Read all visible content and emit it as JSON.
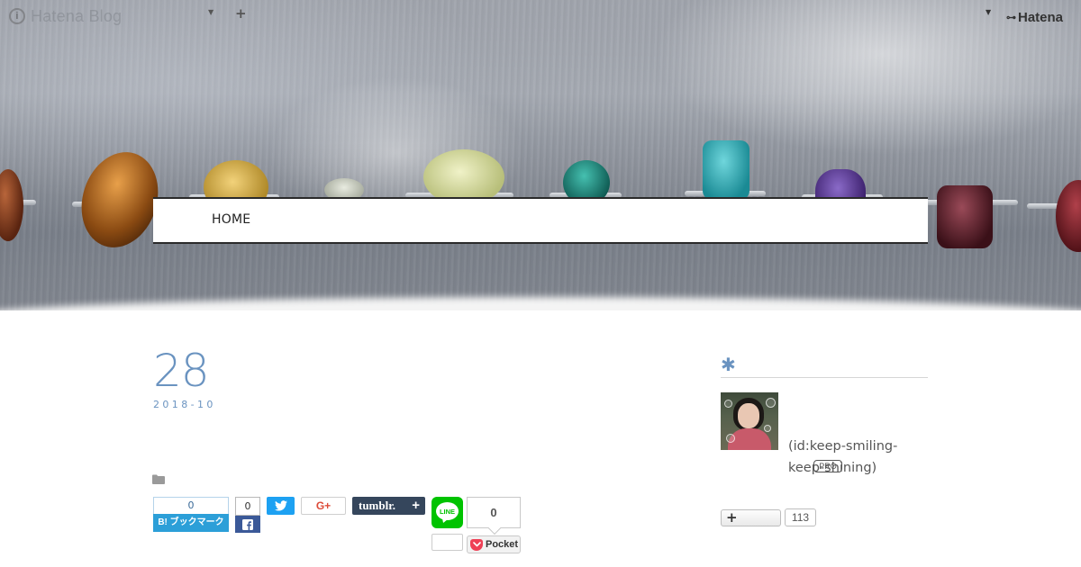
{
  "topbar": {
    "logo_text": "Hatena Blog",
    "logo_mark": "i",
    "dropdown_icon": "caret-down-icon",
    "add_icon": "plus-icon",
    "brand_text": "Hatena"
  },
  "global_nav": {
    "items": [
      {
        "label": "HOME"
      }
    ]
  },
  "article": {
    "day": "28",
    "year_month": "2018-10",
    "category_icon": "folder-icon"
  },
  "share": {
    "hatena_bookmark": {
      "count": "0",
      "label": "B! ブックマーク"
    },
    "facebook": {
      "count": "0",
      "icon": "facebook-icon"
    },
    "twitter": {
      "icon": "twitter-icon"
    },
    "google_plus": {
      "label": "G+"
    },
    "tumblr": {
      "label": "tumblr.",
      "plus": "+"
    },
    "line": {
      "label": "LINE",
      "count": ""
    },
    "pocket": {
      "count": "0",
      "label": "Pocket"
    }
  },
  "sidebar": {
    "heading": "✱",
    "profile": {
      "id_text": "(id:keep-smiling-keep-shining)",
      "badge": "PRO"
    },
    "reader": {
      "button_label": "+",
      "count": "113"
    }
  },
  "colors": {
    "accent": "#6a93c0",
    "hatena_blue": "#2c9fd8",
    "facebook": "#3b5998",
    "twitter": "#1da1f2",
    "google_plus": "#dd4b39",
    "tumblr": "#35465c",
    "line": "#00c300",
    "pocket": "#ef4056"
  }
}
